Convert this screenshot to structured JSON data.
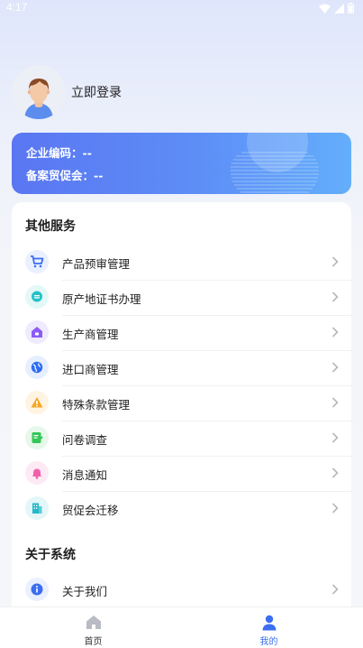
{
  "status_bar": {
    "time": "4:17"
  },
  "profile": {
    "login_text": "立即登录"
  },
  "enterprise": {
    "code_line": "企业编码：--",
    "council_line": "备案贸促会：--"
  },
  "other_services": {
    "title": "其他服务",
    "items": [
      {
        "label": "产品预审管理",
        "icon": "cart-icon",
        "color": "#3b6ef0",
        "bg": "#eaf0ff"
      },
      {
        "label": "原产地证书办理",
        "icon": "badge-icon",
        "color": "#22c3c9",
        "bg": "#e4f8f8"
      },
      {
        "label": "生产商管理",
        "icon": "factory-icon",
        "color": "#8b5cf6",
        "bg": "#f0eaff"
      },
      {
        "label": "进口商管理",
        "icon": "globe-icon",
        "color": "#2c6cf2",
        "bg": "#e6efff"
      },
      {
        "label": "特殊条款管理",
        "icon": "warning-icon",
        "color": "#f5a623",
        "bg": "#fff4e2"
      },
      {
        "label": "问卷调查",
        "icon": "survey-icon",
        "color": "#34c759",
        "bg": "#e7f8ea"
      },
      {
        "label": "消息通知",
        "icon": "bell-icon",
        "color": "#f25fa9",
        "bg": "#fdeaf4"
      },
      {
        "label": "贸促会迁移",
        "icon": "building-icon",
        "color": "#22b8c9",
        "bg": "#e4f6f8"
      }
    ]
  },
  "about_system": {
    "title": "关于系统",
    "items": [
      {
        "label": "关于我们",
        "icon": "info-icon",
        "color": "#3b6ef0",
        "bg": "#eaf0ff"
      }
    ]
  },
  "tabbar": {
    "home_label": "首页",
    "mine_label": "我的",
    "inactive_color": "#b9bcc4",
    "active_color": "#3b6ef0"
  }
}
